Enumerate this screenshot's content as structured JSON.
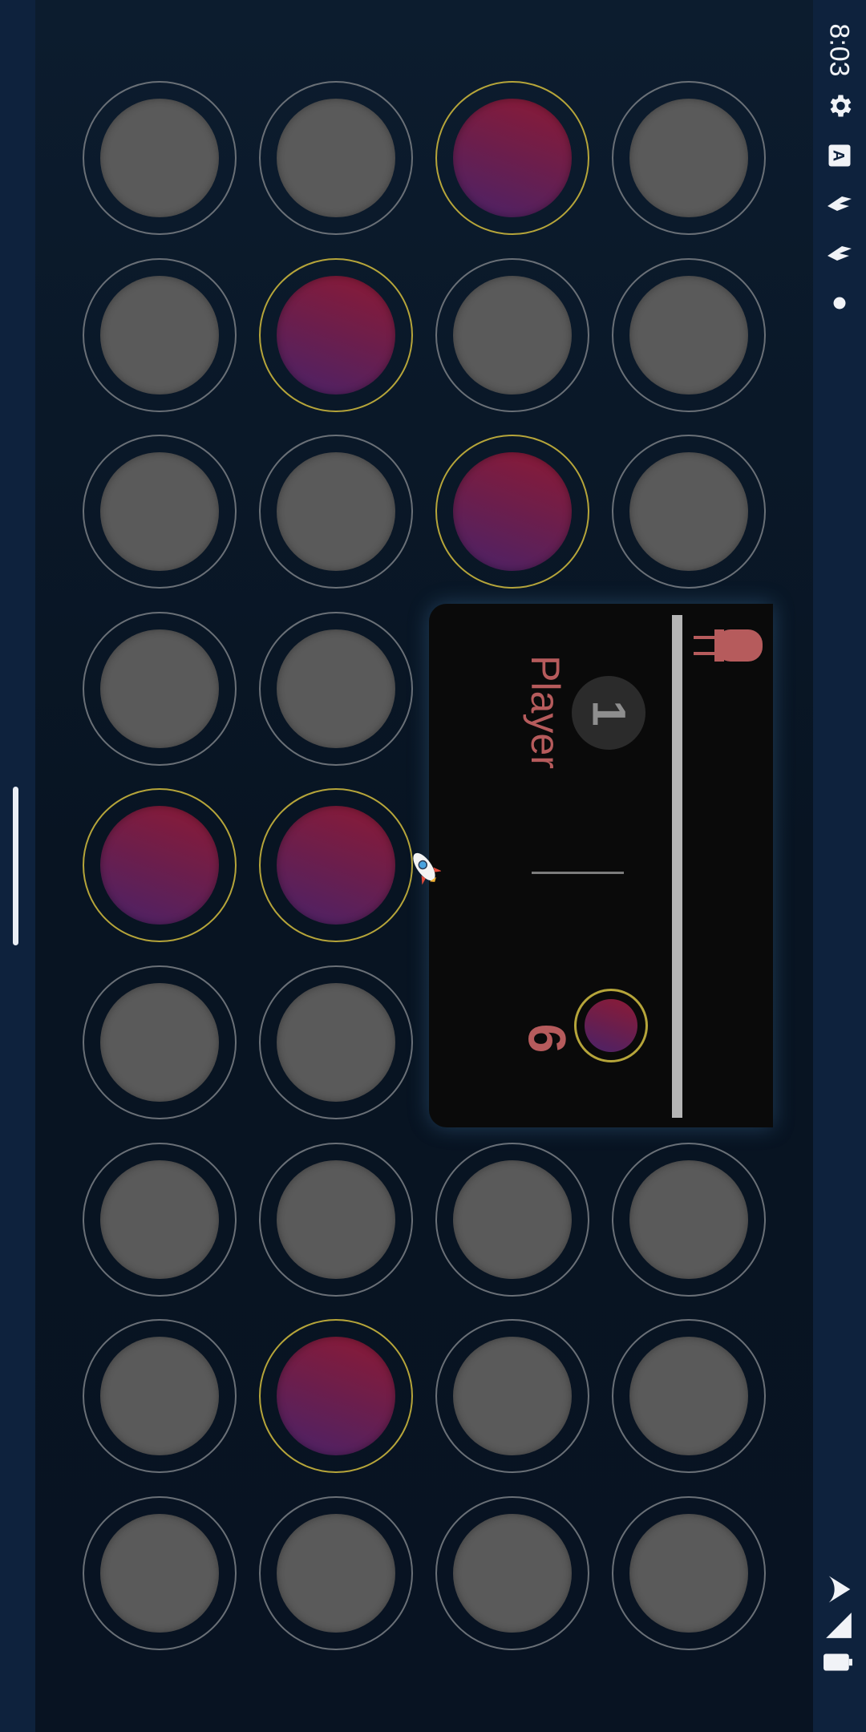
{
  "status_bar": {
    "time": "8:03",
    "icons": [
      "settings-gear-icon",
      "translate-a-icon",
      "bird-notification-icon",
      "bird-notification-icon",
      "dot-icon",
      "wifi-icon",
      "cell-signal-icon",
      "battery-icon"
    ]
  },
  "board": {
    "colors": {
      "empty_disc": "#5a5a5a",
      "selected_ring": "#b6a53a",
      "piece_top": "#8c1a35",
      "piece_bottom": "#4a2268"
    },
    "rows": [
      [
        false,
        false,
        true,
        false
      ],
      [
        false,
        true,
        false,
        false
      ],
      [
        false,
        false,
        true,
        false
      ],
      [
        false,
        false,
        null,
        null
      ],
      [
        true,
        true,
        null,
        null
      ],
      [
        false,
        false,
        null,
        null
      ],
      [
        false,
        false,
        false,
        false
      ],
      [
        false,
        true,
        false,
        false
      ],
      [
        false,
        false,
        false,
        false
      ]
    ]
  },
  "panel": {
    "player_label": "Player",
    "player_number": "1",
    "score": "6",
    "exit_icon": "exit-plug-icon",
    "accent_color": "#b65b5c"
  }
}
